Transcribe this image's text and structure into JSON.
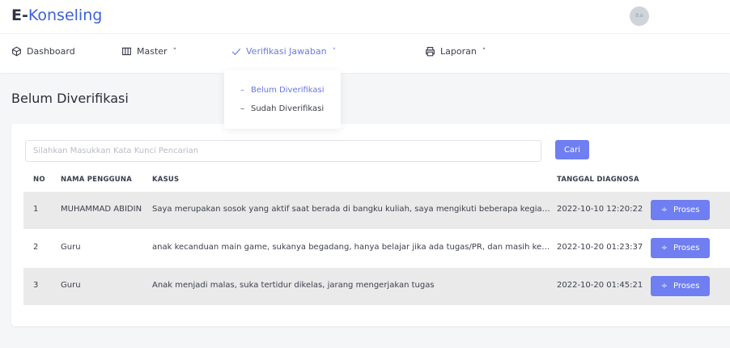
{
  "app": {
    "brand_bold": "E-",
    "brand_rest": "Konseling",
    "avatar_text": "0.o"
  },
  "nav": {
    "dashboard": "Dashboard",
    "master": "Master",
    "verifikasi": "Verifikasi Jawaban",
    "laporan": "Laporan"
  },
  "dropdown": {
    "items": [
      {
        "label": "Belum Diverifikasi",
        "dash": "–"
      },
      {
        "label": "Sudah Diverifikasi",
        "dash": "–"
      }
    ]
  },
  "page": {
    "title": "Belum Diverifikasi"
  },
  "search": {
    "placeholder": "Silahkan Masukkan Kata Kunci Pencarian",
    "button": "Cari"
  },
  "table": {
    "headers": {
      "no": "NO",
      "nama": "NAMA PENGGUNA",
      "kasus": "KASUS",
      "tanggal": "TANGGAL DIAGNOSA"
    },
    "rows": [
      {
        "no": "1",
        "nama": "MUHAMMAD ABIDIN",
        "kasus": "Saya merupakan sosok yang aktif saat berada di bangku kuliah, saya mengikuti beberapa kegiatan dan o...",
        "tanggal": "2022-10-10 12:20:22",
        "action": "Proses"
      },
      {
        "no": "2",
        "nama": "Guru",
        "kasus": "anak kecanduan main game, sukanya begadang, hanya belajar jika ada tugas/PR, dan masih ketergantunga...",
        "tanggal": "2022-10-20 01:23:37",
        "action": "Proses"
      },
      {
        "no": "3",
        "nama": "Guru",
        "kasus": "Anak menjadi malas, suka tertidur dikelas, jarang mengerjakan tugas",
        "tanggal": "2022-10-20 01:45:21",
        "action": "Proses"
      }
    ]
  },
  "colors": {
    "accent": "#6f7ef0",
    "brand_blue": "#3d62d8",
    "row_stripe": "#eaeaeb"
  }
}
